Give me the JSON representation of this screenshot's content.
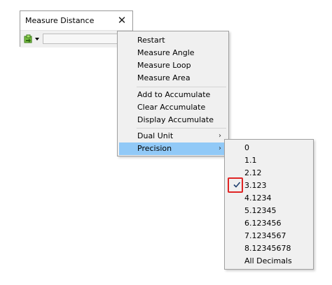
{
  "window": {
    "title": "Measure Distance",
    "close_glyph": "✕",
    "tool_icon": "measure-tool-icon"
  },
  "context_menu": {
    "items": [
      {
        "label": "Restart"
      },
      {
        "label": "Measure Angle"
      },
      {
        "label": "Measure Loop"
      },
      {
        "label": "Measure Area"
      },
      {
        "label": "Add to Accumulate"
      },
      {
        "label": "Clear Accumulate"
      },
      {
        "label": "Display Accumulate"
      },
      {
        "label": "Dual Unit",
        "submenu_arrow": "›"
      },
      {
        "label": "Precision",
        "submenu_arrow": "›",
        "highlighted": true
      }
    ]
  },
  "precision_submenu": {
    "items": [
      {
        "label": "0"
      },
      {
        "label": "1.1"
      },
      {
        "label": "2.12"
      },
      {
        "label": "3.123",
        "checked": true
      },
      {
        "label": "4.1234"
      },
      {
        "label": "5.12345"
      },
      {
        "label": "6.123456"
      },
      {
        "label": "7.1234567"
      },
      {
        "label": "8.12345678"
      },
      {
        "label": "All Decimals"
      }
    ]
  },
  "colors": {
    "highlight": "#91c9f7",
    "check_frame": "#e02424",
    "menu_bg": "#f0f0f0"
  }
}
